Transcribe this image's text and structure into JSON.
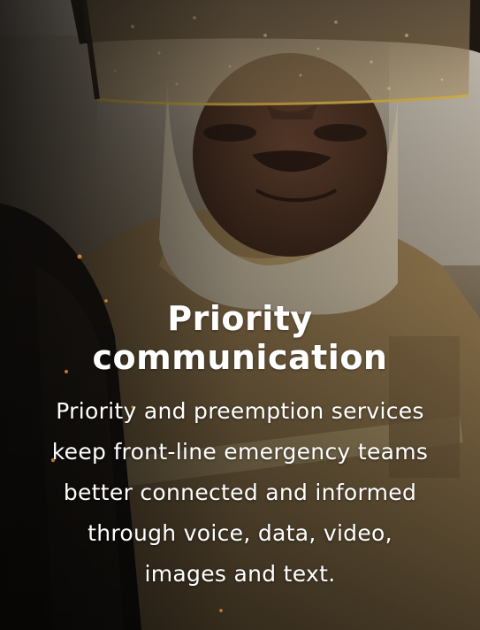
{
  "hero": {
    "headline_lines": [
      "Priority",
      "communication"
    ],
    "body_lines": [
      "Priority and preemption services",
      "keep front-line emergency teams",
      "better connected and informed",
      "through voice, data, video,",
      "images and text."
    ]
  },
  "colors": {
    "text": "#ffffff",
    "turnout_gear": "#a98d5e",
    "background_dark": "#1c1712"
  }
}
